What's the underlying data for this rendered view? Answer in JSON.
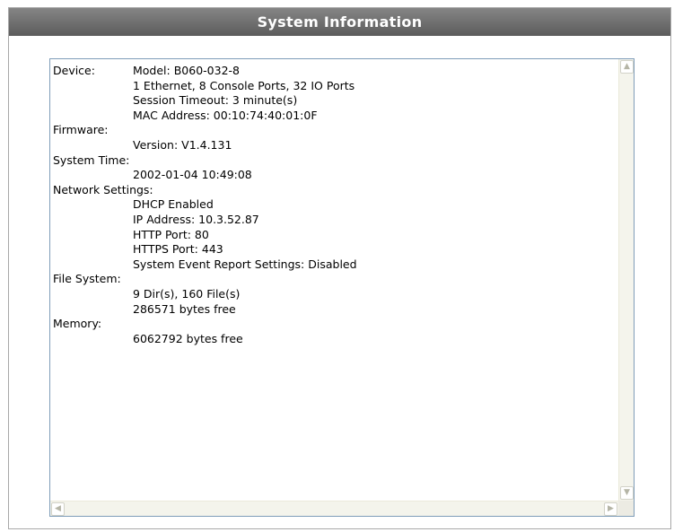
{
  "header": {
    "title": "System Information"
  },
  "info": {
    "device_label": "Device:",
    "device_lines": [
      "Model: B060-032-8",
      "1 Ethernet, 8 Console Ports, 32 IO Ports",
      "Session Timeout:  3 minute(s)",
      "MAC Address:  00:10:74:40:01:0F"
    ],
    "firmware_label": "Firmware:",
    "firmware_lines": [
      "Version:  V1.4.131"
    ],
    "system_time_label": "System Time:",
    "system_time_lines": [
      "2002-01-04 10:49:08"
    ],
    "network_label": "Network Settings:",
    "network_lines": [
      "DHCP Enabled",
      "IP Address:  10.3.52.87",
      "HTTP Port:  80",
      "HTTPS Port:  443",
      "System Event Report Settings:  Disabled"
    ],
    "filesystem_label": "File System:",
    "filesystem_lines": [
      "9 Dir(s), 160 File(s)",
      "286571 bytes free"
    ],
    "memory_label": "Memory:",
    "memory_lines": [
      "6062792 bytes free"
    ]
  },
  "scrollbar": {
    "up_icon": "scroll-up-arrow-icon",
    "down_icon": "scroll-down-arrow-icon",
    "left_icon": "scroll-left-arrow-icon",
    "right_icon": "scroll-right-arrow-icon"
  }
}
